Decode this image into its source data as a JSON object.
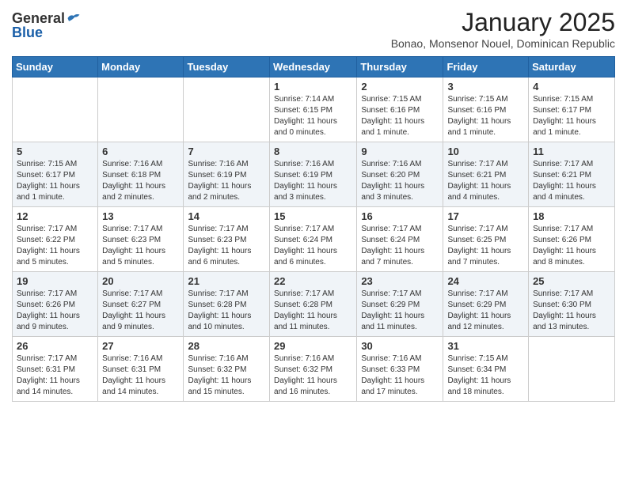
{
  "header": {
    "logo_general": "General",
    "logo_blue": "Blue",
    "month_title": "January 2025",
    "subtitle": "Bonao, Monsenor Nouel, Dominican Republic"
  },
  "weekdays": [
    "Sunday",
    "Monday",
    "Tuesday",
    "Wednesday",
    "Thursday",
    "Friday",
    "Saturday"
  ],
  "weeks": [
    [
      {
        "day": "",
        "info": ""
      },
      {
        "day": "",
        "info": ""
      },
      {
        "day": "",
        "info": ""
      },
      {
        "day": "1",
        "info": "Sunrise: 7:14 AM\nSunset: 6:15 PM\nDaylight: 11 hours\nand 0 minutes."
      },
      {
        "day": "2",
        "info": "Sunrise: 7:15 AM\nSunset: 6:16 PM\nDaylight: 11 hours\nand 1 minute."
      },
      {
        "day": "3",
        "info": "Sunrise: 7:15 AM\nSunset: 6:16 PM\nDaylight: 11 hours\nand 1 minute."
      },
      {
        "day": "4",
        "info": "Sunrise: 7:15 AM\nSunset: 6:17 PM\nDaylight: 11 hours\nand 1 minute."
      }
    ],
    [
      {
        "day": "5",
        "info": "Sunrise: 7:15 AM\nSunset: 6:17 PM\nDaylight: 11 hours\nand 1 minute."
      },
      {
        "day": "6",
        "info": "Sunrise: 7:16 AM\nSunset: 6:18 PM\nDaylight: 11 hours\nand 2 minutes."
      },
      {
        "day": "7",
        "info": "Sunrise: 7:16 AM\nSunset: 6:19 PM\nDaylight: 11 hours\nand 2 minutes."
      },
      {
        "day": "8",
        "info": "Sunrise: 7:16 AM\nSunset: 6:19 PM\nDaylight: 11 hours\nand 3 minutes."
      },
      {
        "day": "9",
        "info": "Sunrise: 7:16 AM\nSunset: 6:20 PM\nDaylight: 11 hours\nand 3 minutes."
      },
      {
        "day": "10",
        "info": "Sunrise: 7:17 AM\nSunset: 6:21 PM\nDaylight: 11 hours\nand 4 minutes."
      },
      {
        "day": "11",
        "info": "Sunrise: 7:17 AM\nSunset: 6:21 PM\nDaylight: 11 hours\nand 4 minutes."
      }
    ],
    [
      {
        "day": "12",
        "info": "Sunrise: 7:17 AM\nSunset: 6:22 PM\nDaylight: 11 hours\nand 5 minutes."
      },
      {
        "day": "13",
        "info": "Sunrise: 7:17 AM\nSunset: 6:23 PM\nDaylight: 11 hours\nand 5 minutes."
      },
      {
        "day": "14",
        "info": "Sunrise: 7:17 AM\nSunset: 6:23 PM\nDaylight: 11 hours\nand 6 minutes."
      },
      {
        "day": "15",
        "info": "Sunrise: 7:17 AM\nSunset: 6:24 PM\nDaylight: 11 hours\nand 6 minutes."
      },
      {
        "day": "16",
        "info": "Sunrise: 7:17 AM\nSunset: 6:24 PM\nDaylight: 11 hours\nand 7 minutes."
      },
      {
        "day": "17",
        "info": "Sunrise: 7:17 AM\nSunset: 6:25 PM\nDaylight: 11 hours\nand 7 minutes."
      },
      {
        "day": "18",
        "info": "Sunrise: 7:17 AM\nSunset: 6:26 PM\nDaylight: 11 hours\nand 8 minutes."
      }
    ],
    [
      {
        "day": "19",
        "info": "Sunrise: 7:17 AM\nSunset: 6:26 PM\nDaylight: 11 hours\nand 9 minutes."
      },
      {
        "day": "20",
        "info": "Sunrise: 7:17 AM\nSunset: 6:27 PM\nDaylight: 11 hours\nand 9 minutes."
      },
      {
        "day": "21",
        "info": "Sunrise: 7:17 AM\nSunset: 6:28 PM\nDaylight: 11 hours\nand 10 minutes."
      },
      {
        "day": "22",
        "info": "Sunrise: 7:17 AM\nSunset: 6:28 PM\nDaylight: 11 hours\nand 11 minutes."
      },
      {
        "day": "23",
        "info": "Sunrise: 7:17 AM\nSunset: 6:29 PM\nDaylight: 11 hours\nand 11 minutes."
      },
      {
        "day": "24",
        "info": "Sunrise: 7:17 AM\nSunset: 6:29 PM\nDaylight: 11 hours\nand 12 minutes."
      },
      {
        "day": "25",
        "info": "Sunrise: 7:17 AM\nSunset: 6:30 PM\nDaylight: 11 hours\nand 13 minutes."
      }
    ],
    [
      {
        "day": "26",
        "info": "Sunrise: 7:17 AM\nSunset: 6:31 PM\nDaylight: 11 hours\nand 14 minutes."
      },
      {
        "day": "27",
        "info": "Sunrise: 7:16 AM\nSunset: 6:31 PM\nDaylight: 11 hours\nand 14 minutes."
      },
      {
        "day": "28",
        "info": "Sunrise: 7:16 AM\nSunset: 6:32 PM\nDaylight: 11 hours\nand 15 minutes."
      },
      {
        "day": "29",
        "info": "Sunrise: 7:16 AM\nSunset: 6:32 PM\nDaylight: 11 hours\nand 16 minutes."
      },
      {
        "day": "30",
        "info": "Sunrise: 7:16 AM\nSunset: 6:33 PM\nDaylight: 11 hours\nand 17 minutes."
      },
      {
        "day": "31",
        "info": "Sunrise: 7:15 AM\nSunset: 6:34 PM\nDaylight: 11 hours\nand 18 minutes."
      },
      {
        "day": "",
        "info": ""
      }
    ]
  ]
}
